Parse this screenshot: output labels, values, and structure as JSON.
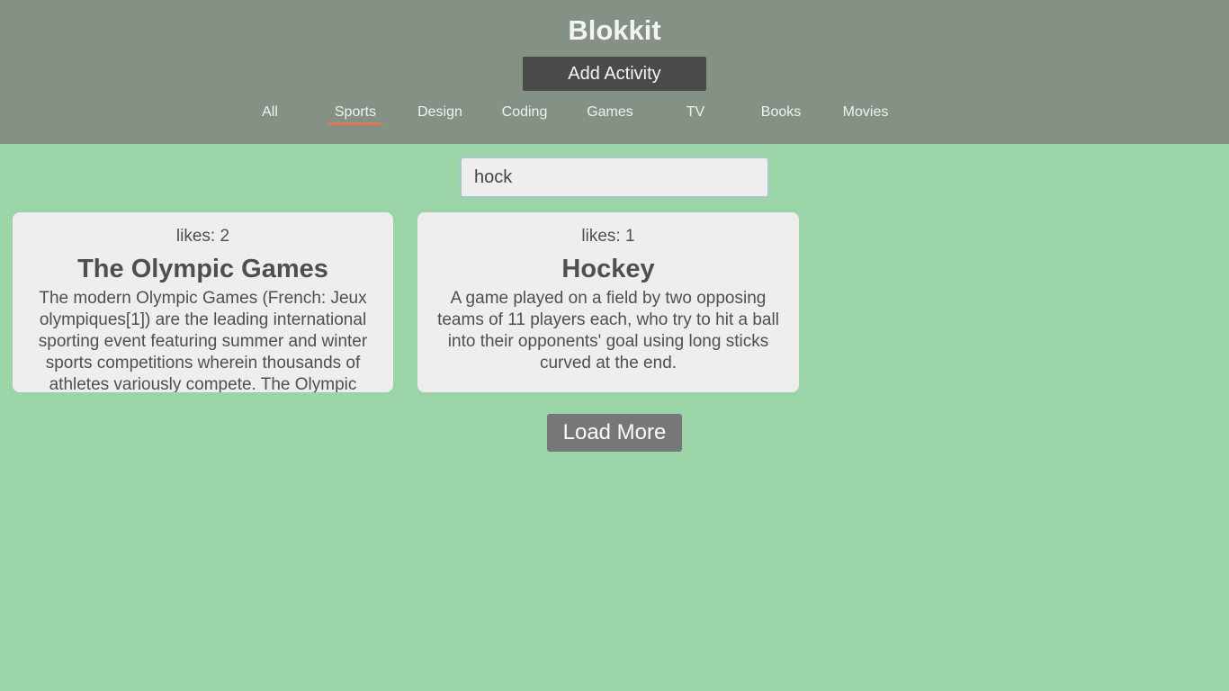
{
  "header": {
    "title": "Blokkit",
    "add_activity_label": "Add Activity"
  },
  "tabs": [
    {
      "label": "All",
      "active": false
    },
    {
      "label": "Sports",
      "active": true
    },
    {
      "label": "Design",
      "active": false
    },
    {
      "label": "Coding",
      "active": false
    },
    {
      "label": "Games",
      "active": false
    },
    {
      "label": "TV",
      "active": false
    },
    {
      "label": "Books",
      "active": false
    },
    {
      "label": "Movies",
      "active": false
    }
  ],
  "search": {
    "value": "hock"
  },
  "cards": [
    {
      "likes": "likes: 2",
      "title": "The Olympic Games",
      "description": "The modern Olympic Games (French: Jeux olympiques[1]) are the leading international sporting event featuring summer and winter sports competitions wherein thousands of athletes variously compete. The Olympic"
    },
    {
      "likes": "likes: 1",
      "title": "Hockey",
      "description": "A game played on a field by two opposing teams of 11 players each, who try to hit a ball into their opponents' goal using long sticks curved at the end."
    }
  ],
  "load_more_label": "Load More",
  "colors": {
    "background": "#9bd5a7",
    "header": "#849184",
    "accent": "#e07a4c"
  }
}
